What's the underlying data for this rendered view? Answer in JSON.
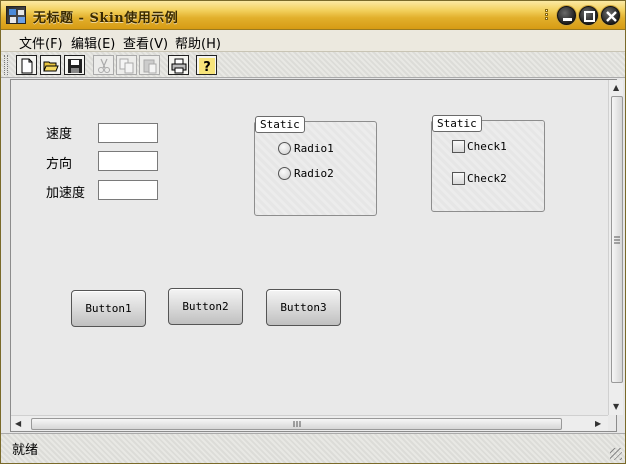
{
  "window": {
    "title": "无标题 - Skin使用示例"
  },
  "menu": {
    "items": [
      {
        "label": "文件(F)"
      },
      {
        "label": "编辑(E)"
      },
      {
        "label": "查看(V)"
      },
      {
        "label": "帮助(H)"
      }
    ]
  },
  "toolbar": {
    "buttons": [
      {
        "icon": "new-file-icon",
        "enabled": true
      },
      {
        "icon": "open-folder-icon",
        "enabled": true
      },
      {
        "icon": "save-icon",
        "enabled": true
      },
      {
        "icon": "cut-icon",
        "enabled": false
      },
      {
        "icon": "copy-icon",
        "enabled": false
      },
      {
        "icon": "paste-icon",
        "enabled": false
      },
      {
        "icon": "print-icon",
        "enabled": true
      },
      {
        "icon": "help-icon",
        "enabled": true
      }
    ]
  },
  "form": {
    "labels": {
      "speed": "速度",
      "direction": "方向",
      "acceleration": "加速度"
    },
    "values": {
      "speed": "",
      "direction": "",
      "acceleration": ""
    }
  },
  "groups": {
    "radio_group": {
      "caption": "Static",
      "options": [
        "Radio1",
        "Radio2"
      ]
    },
    "check_group": {
      "caption": "Static",
      "options": [
        "Check1",
        "Check2"
      ]
    }
  },
  "buttons": [
    "Button1",
    "Button2",
    "Button3"
  ],
  "statusbar": {
    "text": "就绪"
  },
  "colors": {
    "titlebar": "#e2b02c",
    "client_bg": "#e9e9e9",
    "frame_bg": "#e6e6e6"
  }
}
